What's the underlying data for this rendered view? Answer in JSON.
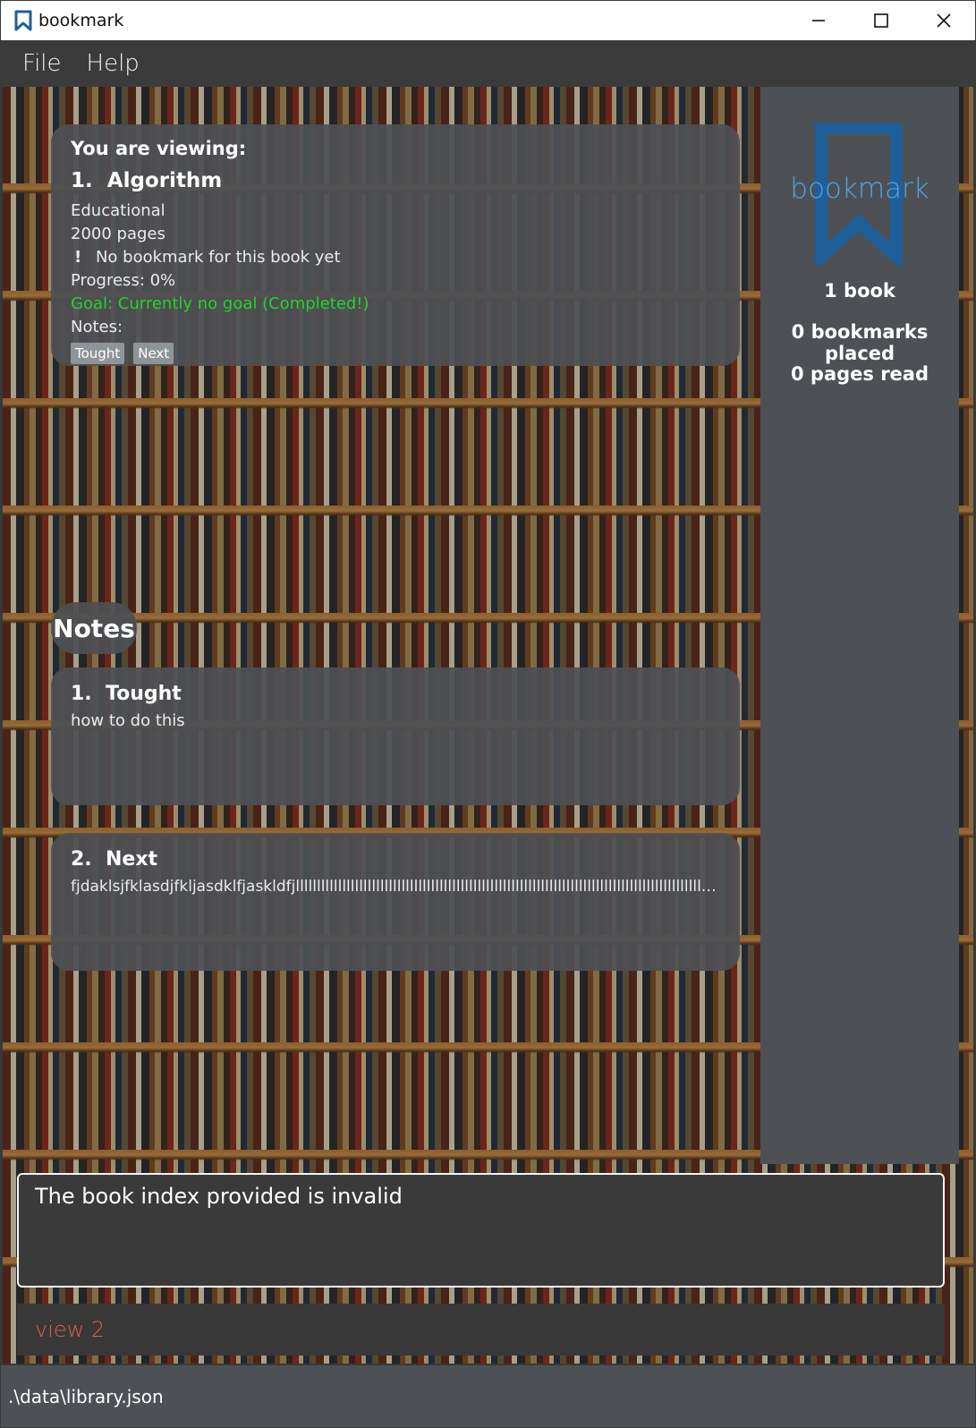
{
  "window": {
    "title": "bookmark",
    "controls": [
      "minimize",
      "maximize",
      "close"
    ]
  },
  "menu": {
    "file": "File",
    "help": "Help"
  },
  "viewing": {
    "header": "You are viewing:",
    "index": "1.",
    "title": "Algorithm",
    "genre": "Educational",
    "pages": "2000 pages",
    "bookmark_status": "No bookmark for this book yet",
    "progress": "Progress: 0%",
    "goal": "Goal: Currently no goal (Completed!)",
    "notes_label": "Notes:",
    "note_tags": [
      "Tought",
      "Next"
    ]
  },
  "notes_section": {
    "label": "Notes",
    "items": [
      {
        "index": "1.",
        "title": "Tought",
        "text": "how to do this"
      },
      {
        "index": "2.",
        "title": "Next",
        "text": "fjdaklsjfklasdjfkljasdklfjaskldfjllllllllllllllllllllllllllllllllllllllllllllllllllllllllllllllllllllllllllllllllllllllllllllllllllllllllllllllllllllllllllllllllllllllllll..."
      }
    ]
  },
  "sidebar": {
    "logo_text": "bookmark",
    "books": "1 book",
    "bookmarks": "0 bookmarks placed",
    "pages_read": "0 pages read"
  },
  "result": {
    "message": "The book index provided is invalid"
  },
  "command": {
    "value": "view 2"
  },
  "status": {
    "path": ".\\data\\library.json"
  },
  "colors": {
    "accent": "#4fa3e0",
    "goal": "#22d32a",
    "command_error": "#e05c4e",
    "panel": "#4d5155"
  }
}
